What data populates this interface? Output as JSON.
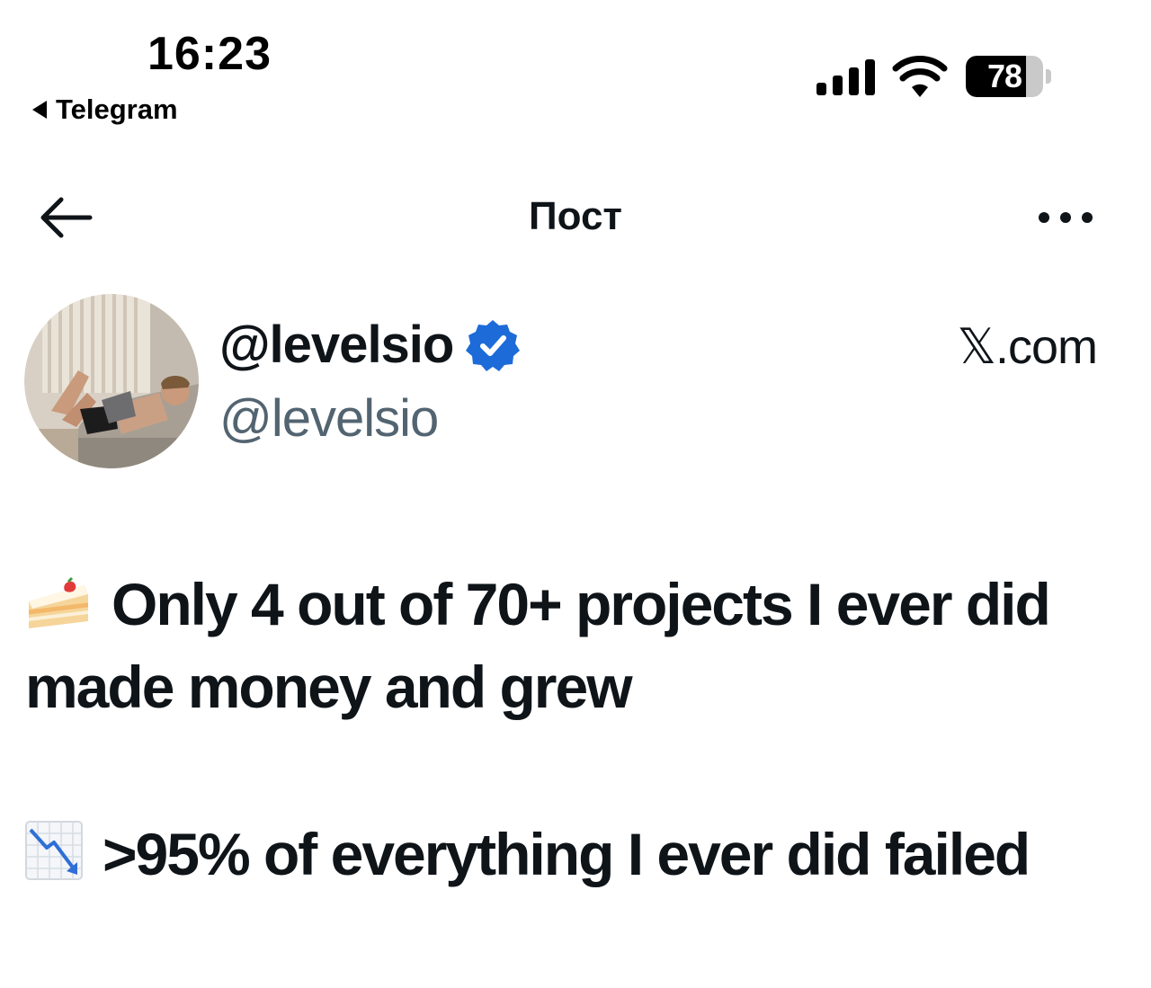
{
  "status_bar": {
    "time": "16:23",
    "back_app": "Telegram",
    "battery_level": 78,
    "battery_label": "78",
    "signal_icon": "cellular-signal-icon",
    "wifi_icon": "wifi-icon"
  },
  "nav": {
    "title": "Пост",
    "back_icon": "arrow-left-icon",
    "more_icon": "more-horizontal-icon"
  },
  "author": {
    "display_name": "@levelsio",
    "handle": "@levelsio",
    "verified_icon": "verified-badge-icon",
    "source": "𝕏.com"
  },
  "tweet": {
    "paragraphs": [
      {
        "emoji": "cake-icon",
        "text": "Only 4 out of 70+ projects I ever did made money and grew"
      },
      {
        "emoji": "chart-decreasing-icon",
        "text": ">95% of everything I ever did failed"
      }
    ]
  },
  "colors": {
    "text_primary": "#0f1419",
    "text_secondary": "#536471",
    "verified_blue": "#1d6bd9"
  }
}
